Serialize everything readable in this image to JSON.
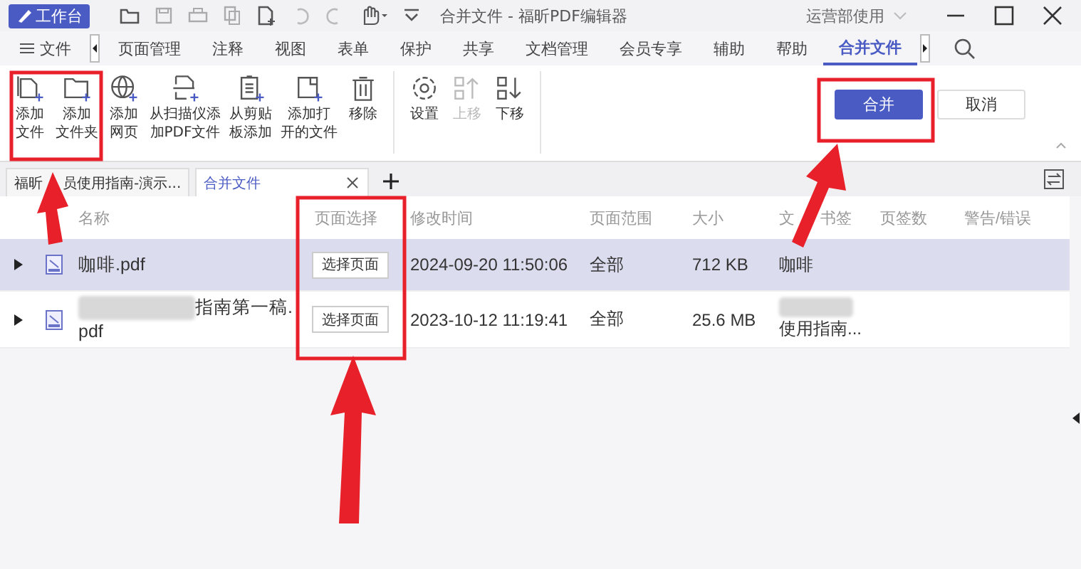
{
  "title_bar": {
    "workbench_button": "工作台",
    "title": "合并文件 - 福昕PDF编辑器",
    "user": "运营部使用"
  },
  "ribbon_tabs": [
    {
      "label": "文件",
      "kind": "menu",
      "selected": false
    },
    {
      "label": "页面管理",
      "kind": "tab",
      "selected": false
    },
    {
      "label": "注释",
      "kind": "tab",
      "selected": false
    },
    {
      "label": "视图",
      "kind": "tab",
      "selected": false
    },
    {
      "label": "表单",
      "kind": "tab",
      "selected": false
    },
    {
      "label": "保护",
      "kind": "tab",
      "selected": false
    },
    {
      "label": "共享",
      "kind": "tab",
      "selected": false
    },
    {
      "label": "文档管理",
      "kind": "tab",
      "selected": false
    },
    {
      "label": "会员专享",
      "kind": "tab",
      "selected": false
    },
    {
      "label": "辅助",
      "kind": "tab",
      "selected": false
    },
    {
      "label": "帮助",
      "kind": "tab",
      "selected": false
    },
    {
      "label": "合并文件",
      "kind": "tab",
      "selected": true
    }
  ],
  "toolbar": [
    {
      "label": "添加文件",
      "disabled": false
    },
    {
      "label": "添加文件夹",
      "disabled": false
    },
    {
      "label": "添加网页",
      "disabled": false
    },
    {
      "label": "从扫描仪添加PDF文件",
      "disabled": false
    },
    {
      "label": "从剪贴板添加",
      "disabled": false
    },
    {
      "label": "添加打开的文件",
      "disabled": false
    },
    {
      "label": "移除",
      "disabled": false
    },
    {
      "label": "设置",
      "disabled": false
    },
    {
      "label": "上移",
      "disabled": true
    },
    {
      "label": "下移",
      "disabled": false
    }
  ],
  "actions": [
    {
      "label": "合并",
      "primary": true
    },
    {
      "label": "取消",
      "primary": false
    }
  ],
  "doc_tabs": [
    {
      "label_parts": [
        "福昕",
        "员使用指南-演示..."
      ],
      "selected": false
    },
    {
      "label_parts": [
        "合并文件"
      ],
      "selected": true
    }
  ],
  "table": {
    "columns": [
      "名称",
      "页面选择",
      "修改时间",
      "页面范围",
      "大小",
      "文 书签",
      "页签数",
      "警告/错误"
    ],
    "rows": [
      {
        "name": "咖啡.pdf",
        "name_redacted": false,
        "page_button": "选择页面",
        "modified": "2024-09-20 11:50:06",
        "range": "全部",
        "size": "712 KB",
        "bookmark": "咖啡",
        "bookmark_redacted": false,
        "selected": true
      },
      {
        "name": "指南第一稿.\npdf",
        "name_redacted": true,
        "page_button": "选择页面",
        "modified": "2023-10-12 11:19:41",
        "range": "全部",
        "size": "25.6 MB",
        "bookmark": "使用指南...",
        "bookmark_redacted": true,
        "selected": false
      }
    ]
  }
}
